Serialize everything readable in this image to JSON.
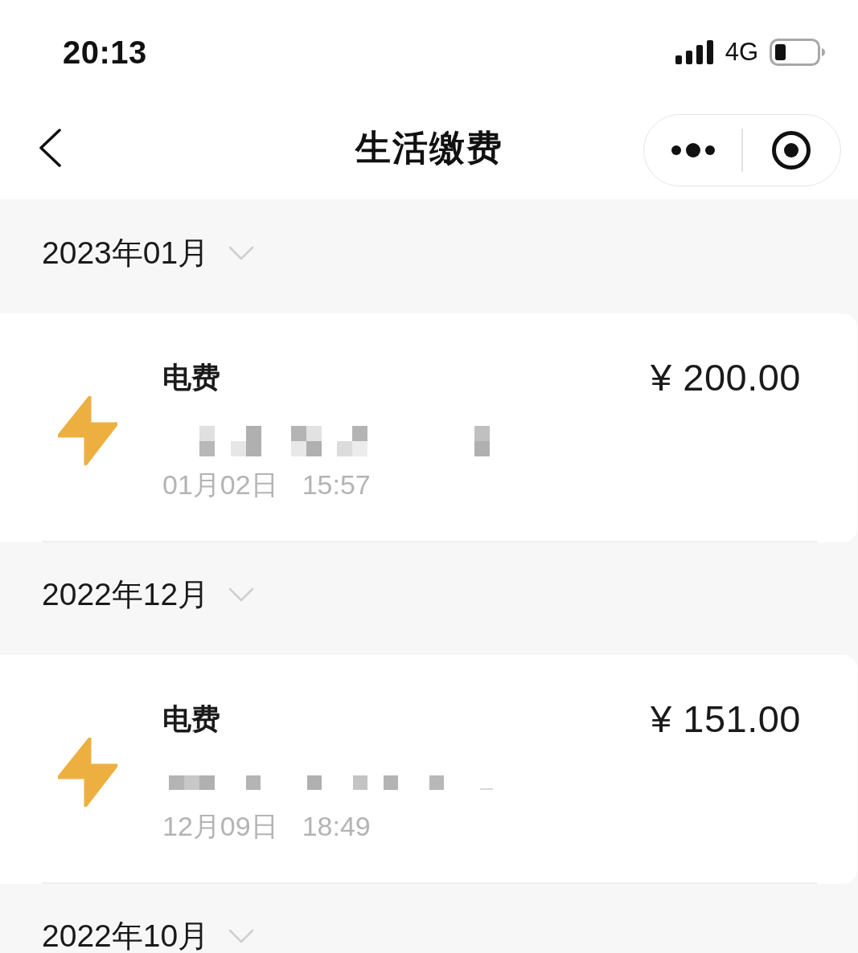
{
  "status_bar": {
    "time": "20:13",
    "network": "4G"
  },
  "nav": {
    "title": "生活缴费"
  },
  "months": [
    {
      "label": "2023年01月",
      "records": [
        {
          "kind": "electricity",
          "title": "电费",
          "amount": "¥ 200.00",
          "date": "01月02日",
          "time": "15:57",
          "detail_redacted": true
        }
      ]
    },
    {
      "label": "2022年12月",
      "records": [
        {
          "kind": "electricity",
          "title": "电费",
          "amount": "¥ 151.00",
          "date": "12月09日",
          "time": "18:49",
          "detail_redacted": true
        }
      ]
    },
    {
      "label": "2022年10月"
    }
  ]
}
